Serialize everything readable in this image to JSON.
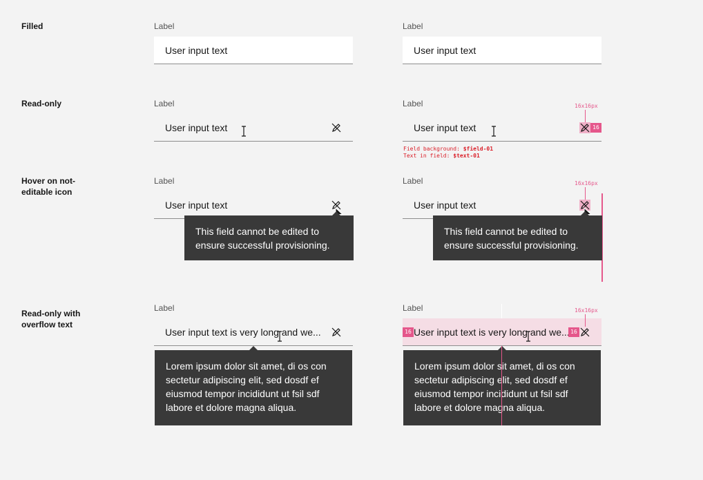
{
  "rows": {
    "filled": "Filled",
    "readonly": "Read-only",
    "hover": "Hover on not-editable icon",
    "hover_line1": "Hover on not-",
    "hover_line2": "editable icon",
    "overflow_line1": "Read-only with",
    "overflow_line2": "overflow text"
  },
  "field": {
    "label": "Label",
    "value": "User input text",
    "overflow_value": "User input text is very long and we..."
  },
  "tooltips": {
    "not_editable_line1": "This field cannot be edited to",
    "not_editable_line2": "ensure successful provisioning.",
    "overflow_line1": "Lorem ipsum dolor sit amet, di os con",
    "overflow_line2": "sectetur adipiscing elit, sed dosdf ef",
    "overflow_line3": "eiusmod tempor incididunt ut fsil sdf",
    "overflow_line4": "labore et dolore magna aliqua."
  },
  "specs": {
    "icon_size": "16x16px",
    "badge": "16",
    "bg_label": "Field background:",
    "bg_token": "$field-01",
    "text_label": "Text in field:",
    "text_token": "$text-01"
  },
  "icons": {
    "edit_off": "edit-off-icon",
    "text_cursor": "text-cursor-icon",
    "pointer": "pointer-icon"
  },
  "colors": {
    "spec_pink": "#e5578b",
    "tooltip_bg": "#393939",
    "field_bg": "#ffffff",
    "page_bg": "#f3f3f3"
  }
}
